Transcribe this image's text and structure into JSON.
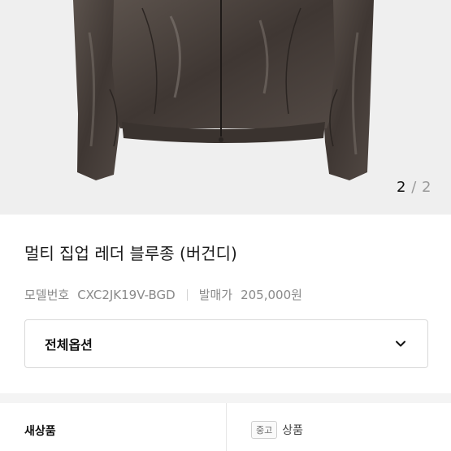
{
  "gallery": {
    "current": "2",
    "separator": "/",
    "total": "2"
  },
  "product": {
    "title": "멀티 집업 레더 블루종 (버건디)",
    "model_label": "모델번호",
    "model_value": "CXC2JK19V-BGD",
    "price_label": "발매가",
    "price_value": "205,000원"
  },
  "option_select": {
    "label": "전체옵션"
  },
  "condition": {
    "new_label": "새상품",
    "used_badge": "중고",
    "used_label": "상품"
  },
  "colors": {
    "jacket": "#4a413c",
    "background": "#efefef"
  }
}
